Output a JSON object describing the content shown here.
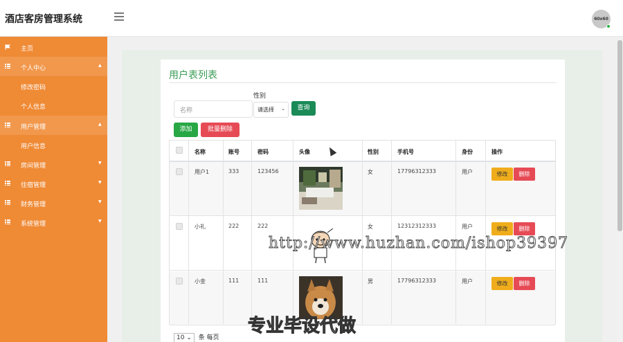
{
  "app": {
    "title": "酒店客房管理系统",
    "avatar_text": "60x60"
  },
  "sidebar": {
    "home": "主页",
    "groups": [
      {
        "label": "个人中心",
        "children": [
          "修改密码",
          "个人信息"
        ]
      },
      {
        "label": "用户管理",
        "children": [
          "用户信息"
        ]
      },
      {
        "label": "房间管理",
        "children": []
      },
      {
        "label": "住宿管理",
        "children": []
      },
      {
        "label": "财务管理",
        "children": []
      },
      {
        "label": "系统管理",
        "children": []
      }
    ]
  },
  "page": {
    "title": "用户表列表",
    "search": {
      "name_placeholder": "名称",
      "sex_label": "性别",
      "sex_selected": "请选择",
      "query_label": "查询"
    },
    "actions": {
      "add_label": "添加",
      "batch_delete_label": "批量删除"
    },
    "table": {
      "columns": [
        "名称",
        "账号",
        "密码",
        "头像",
        "性别",
        "手机号",
        "身份",
        "操作"
      ],
      "rows": [
        {
          "name": "用户1",
          "account": "333",
          "password": "123456",
          "sex": "女",
          "phone": "17796312333",
          "role": "用户"
        },
        {
          "name": "小礼",
          "account": "222",
          "password": "222",
          "sex": "女",
          "phone": "12312312333",
          "role": "用户"
        },
        {
          "name": "小金",
          "account": "111",
          "password": "111",
          "sex": "男",
          "phone": "17796312333",
          "role": "用户"
        }
      ],
      "edit_label": "修改",
      "delete_label": "删除"
    },
    "pager": {
      "page_size": "10",
      "suffix": "条 每页"
    }
  },
  "watermark": {
    "url": "http://www.huzhan.com/ishop39397",
    "slogan": "专业毕设代做"
  },
  "colors": {
    "sidebar": "#ef8a35",
    "title_green": "#3a9b55",
    "query": "#1a8a57",
    "add": "#28a745",
    "danger": "#e64b55",
    "warning": "#f0ad1b"
  }
}
